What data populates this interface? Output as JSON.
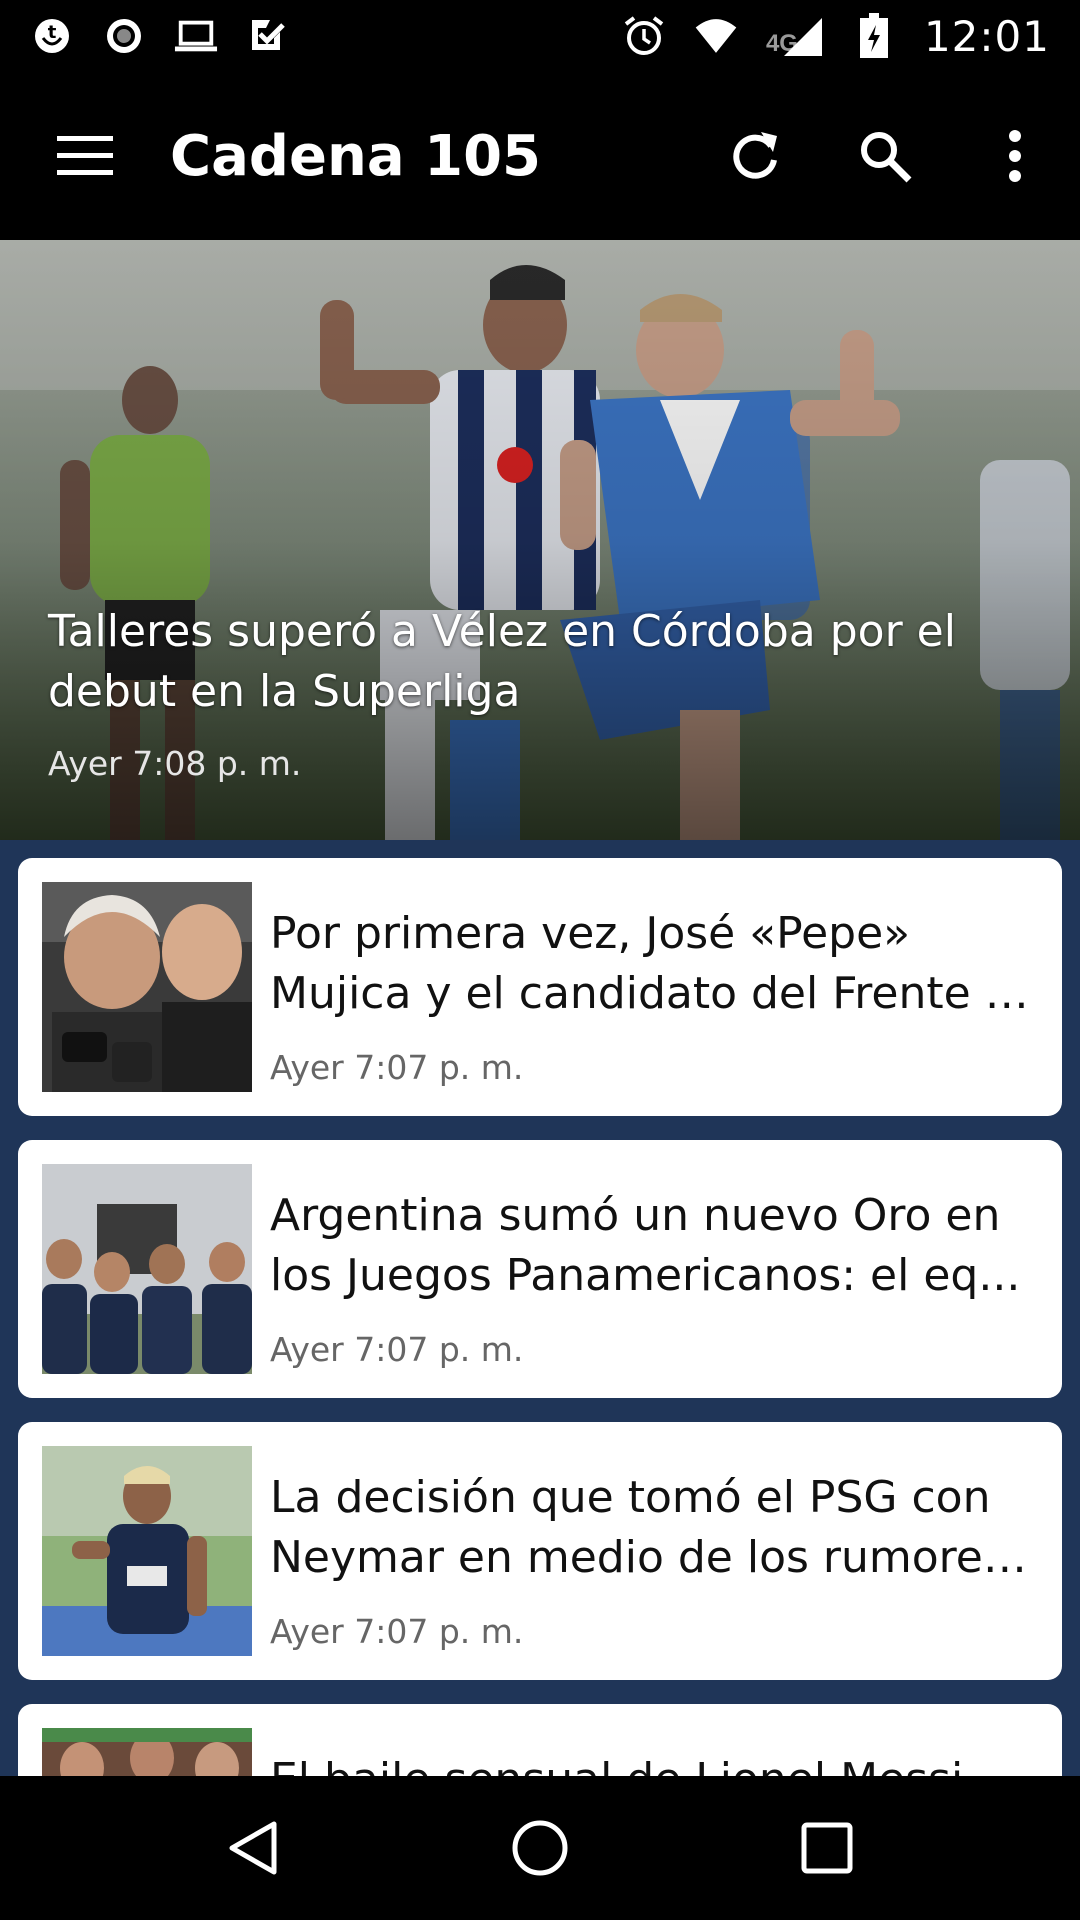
{
  "status_bar": {
    "time": "12:01",
    "network": "4G",
    "left_icons": [
      "tumblr-notification-icon",
      "record-icon",
      "laptop-icon",
      "task-check-icon"
    ],
    "right_icons": [
      "alarm-icon",
      "wifi-icon",
      "cell-signal-icon",
      "battery-charging-icon"
    ]
  },
  "app_bar": {
    "title": "Cadena 105",
    "menu_icon": "hamburger-menu-icon",
    "actions": [
      "refresh-icon",
      "search-icon",
      "more-vert-icon"
    ],
    "background": "#000000"
  },
  "hero": {
    "title": "Talleres superó a Vélez en Córdoba por el debut en la Superliga",
    "time": "Ayer 7:08 p. m."
  },
  "articles": [
    {
      "title_line1": "Por primera vez, José «Pepe»",
      "title_line2": "Mujica y el candidato del Frente A...",
      "time": "Ayer 7:07 p. m."
    },
    {
      "title_line1": "Argentina sumó un nuevo Oro en",
      "title_line2": "los Juegos Panamericanos: el eq...",
      "time": "Ayer 7:07 p. m."
    },
    {
      "title_line1": "La decisión que tomó el PSG con",
      "title_line2": "Neymar en medio de los rumores ...",
      "time": "Ayer 7:07 p. m."
    },
    {
      "title_line1": "El baile sensual de Lionel Messi",
      "title_line2": "",
      "time": ""
    }
  ],
  "nav_bar": {
    "buttons": [
      "back-icon",
      "home-icon",
      "recents-icon"
    ]
  },
  "colors": {
    "list_background": "#1f3558",
    "card_background": "#ffffff",
    "bars": "#000000"
  }
}
